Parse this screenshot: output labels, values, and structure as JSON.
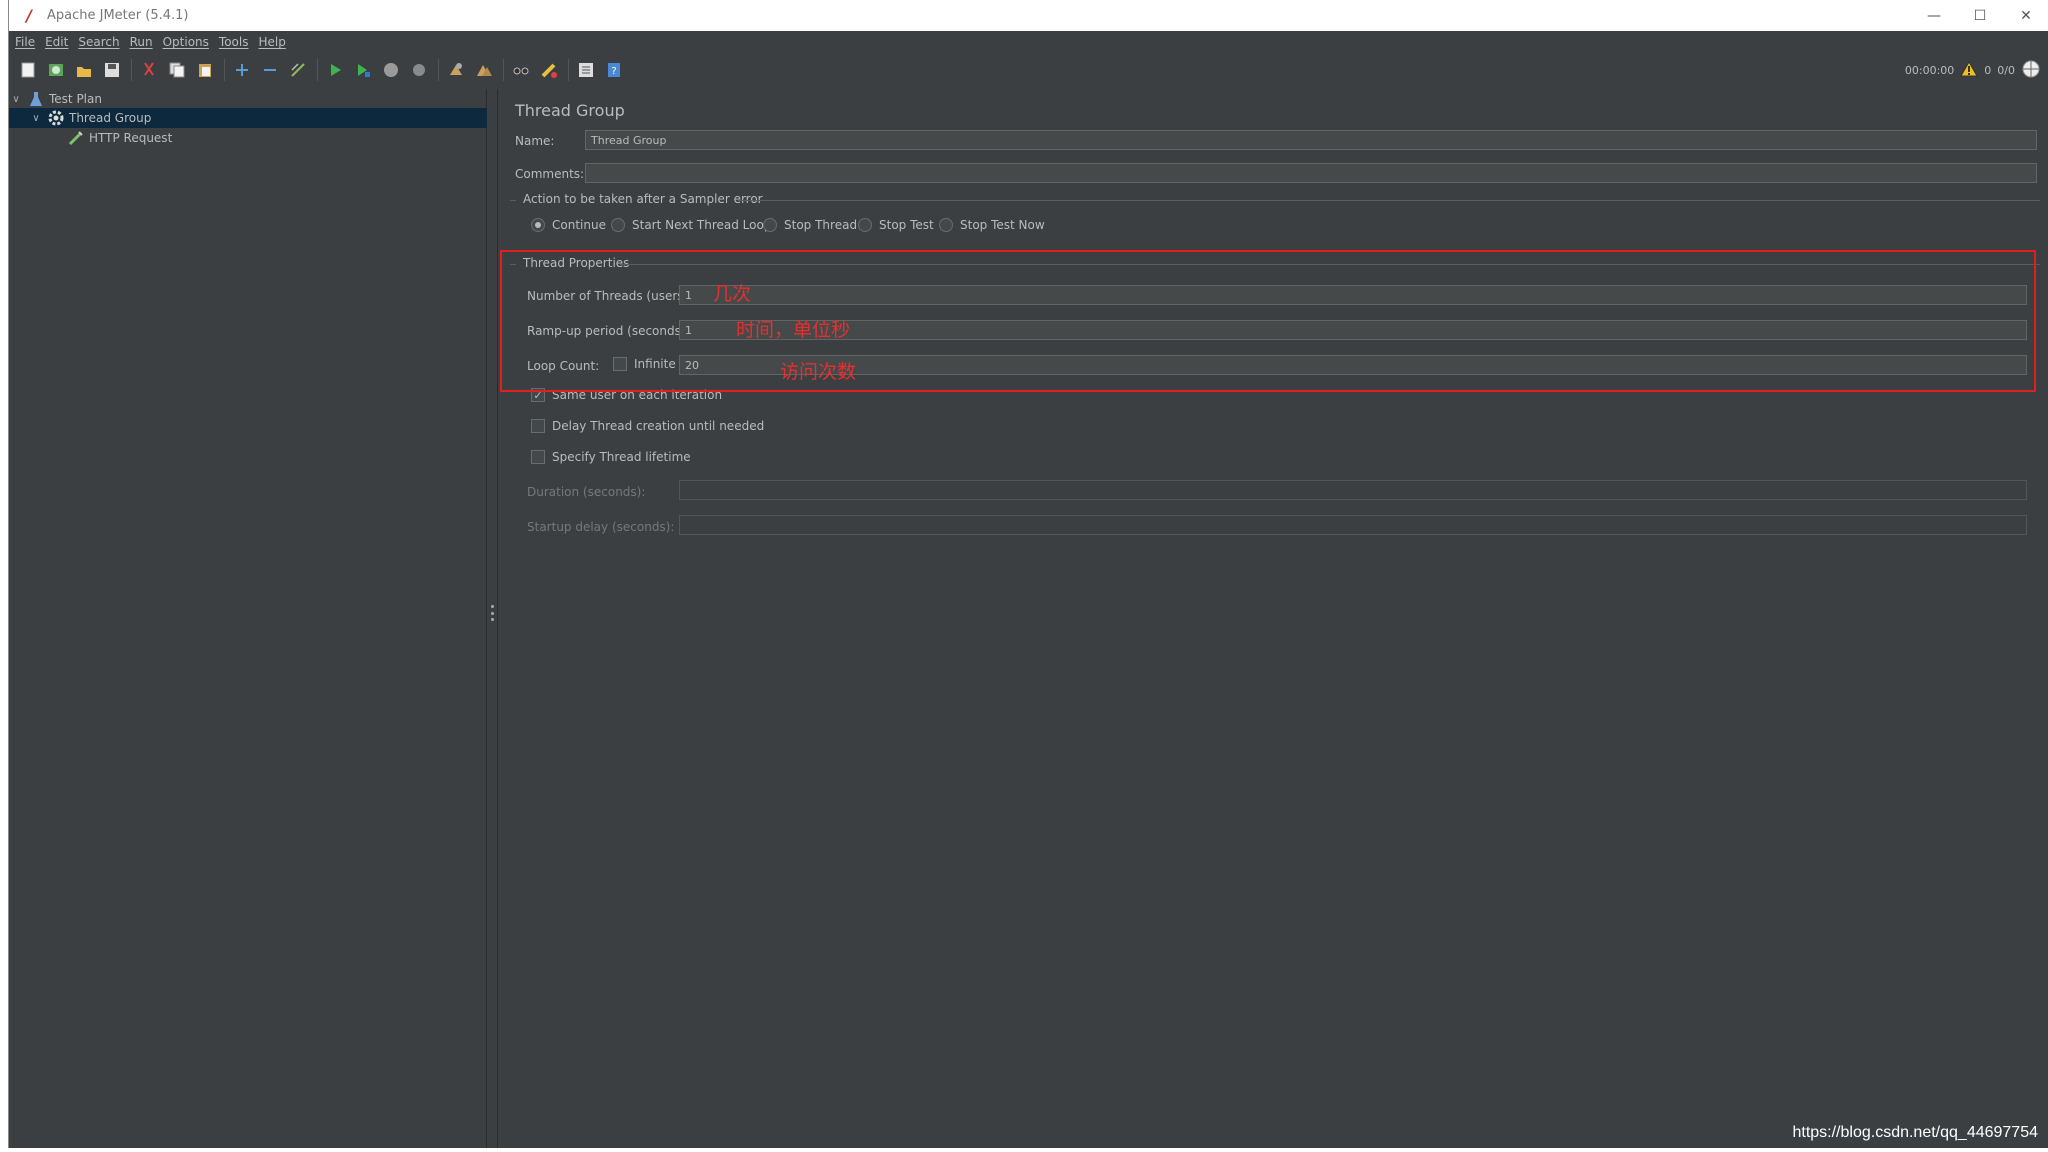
{
  "window": {
    "title": "Apache JMeter (5.4.1)"
  },
  "menu": [
    "File",
    "Edit",
    "Search",
    "Run",
    "Options",
    "Tools",
    "Help"
  ],
  "toolbar": {
    "icons": [
      "new-icon",
      "templates-icon",
      "open-icon",
      "save-icon",
      "cut-icon",
      "copy-icon",
      "paste-icon",
      "expand-icon",
      "collapse-icon",
      "toggle-icon",
      "start-icon",
      "start-no-pause-icon",
      "stop-icon",
      "shutdown-icon",
      "clear-icon",
      "clear-all-icon",
      "search-icon",
      "reset-search-icon",
      "function-helper-icon",
      "help-icon"
    ],
    "timer": "00:00:00",
    "warnings": "0",
    "threads": "0/0"
  },
  "tree": {
    "items": [
      {
        "label": "Test Plan",
        "icon": "flask-icon",
        "level": 0,
        "expanded": true
      },
      {
        "label": "Thread Group",
        "icon": "gear-icon",
        "level": 1,
        "expanded": true,
        "selected": true
      },
      {
        "label": "HTTP Request",
        "icon": "pipette-icon",
        "level": 2
      }
    ]
  },
  "panel": {
    "title": "Thread Group",
    "name_label": "Name:",
    "name_value": "Thread Group",
    "comments_label": "Comments:",
    "comments_value": "",
    "error_section": "Action to be taken after a Sampler error",
    "error_options": [
      {
        "label": "Continue",
        "selected": true
      },
      {
        "label": "Start Next Thread Loop",
        "selected": false
      },
      {
        "label": "Stop Thread",
        "selected": false
      },
      {
        "label": "Stop Test",
        "selected": false
      },
      {
        "label": "Stop Test Now",
        "selected": false
      }
    ],
    "thread_section": "Thread Properties",
    "threads_label": "Number of Threads (users):",
    "threads_value": "1",
    "rampup_label": "Ramp-up period (seconds):",
    "rampup_value": "1",
    "loop_label": "Loop Count:",
    "infinite_label": "Infinite",
    "infinite_checked": false,
    "loop_value": "20",
    "same_user_label": "Same user on each iteration",
    "same_user_checked": true,
    "delay_label": "Delay Thread creation until needed",
    "delay_checked": false,
    "lifetime_label": "Specify Thread lifetime",
    "lifetime_checked": false,
    "duration_label": "Duration (seconds):",
    "duration_value": "",
    "startup_label": "Startup delay (seconds):",
    "startup_value": ""
  },
  "annotations": {
    "threads_note": "几次",
    "rampup_note": "时间，单位秒",
    "loop_note": "访问次数"
  },
  "watermark": "https://blog.csdn.net/qq_44697754"
}
